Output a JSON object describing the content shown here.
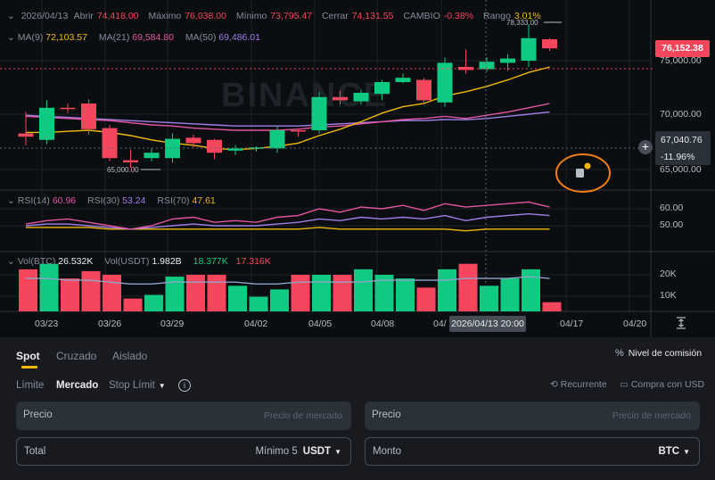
{
  "ohlc": {
    "date": "2026/04/13",
    "open_label": "Abrir",
    "open": "74,418.00",
    "max_label": "Máximo",
    "max": "76,038.00",
    "min_label": "Mínimo",
    "min": "73,795.47",
    "close_label": "Cerrar",
    "close": "74,131.55",
    "change_label": "CAMBIO",
    "change": "-0.38%",
    "range_label": "Rango",
    "range": "3.01%"
  },
  "ma": {
    "ma9_label": "MA(9)",
    "ma9": "72,103.57",
    "ma21_label": "MA(21)",
    "ma21": "69,584.80",
    "ma50_label": "MA(50)",
    "ma50": "69,486.01"
  },
  "rsi": {
    "rsi14_label": "RSI(14)",
    "rsi14": "60.96",
    "rsi30_label": "RSI(30)",
    "rsi30": "53.24",
    "rsi70_label": "RSI(70)",
    "rsi70": "47.61"
  },
  "vol": {
    "btc_label": "Vol(BTC)",
    "btc": "26.532K",
    "usdt_label": "Vol(USDT)",
    "usdt": "1.982B",
    "buy": "18.377K",
    "sell": "17.316K"
  },
  "price_axis": [
    "75,000.00",
    "70,000.00",
    "65,000.00"
  ],
  "rsi_axis": [
    "60.00",
    "50.00"
  ],
  "vol_axis": [
    "20K",
    "10K"
  ],
  "date_axis": [
    "03/23",
    "03/26",
    "03/29",
    "04/02",
    "04/05",
    "04/08",
    "04/",
    "04/17",
    "04/20"
  ],
  "current_price": "76,152.38",
  "crosshair_price": "67,040.76",
  "crosshair_pct": "-11.96%",
  "crosshair_date": "2026/04/13 20:00",
  "high_marker": "78,333.00",
  "low_marker": "65,000.00",
  "watermark": "BINANCE",
  "colors": {
    "up": "#0ecb81",
    "down": "#f6465d",
    "accent": "#f0b90b",
    "ma21": "#e255a1",
    "ma50": "#a07ee6"
  },
  "trade": {
    "tabs": [
      "Spot",
      "Cruzado",
      "Aislado"
    ],
    "fee_label": "Nivel de comisión",
    "order_types": [
      "Límite",
      "Mercado",
      "Stop Límit"
    ],
    "recurring": "Recurrente",
    "buy_usd": "Compra con USD",
    "left_price_label": "Precio",
    "left_price_placeholder": "Precio de mercado",
    "right_price_label": "Precio",
    "right_price_placeholder": "Precio de mercado",
    "total_label": "Total",
    "min_label": "Mínimo 5",
    "total_unit": "USDT",
    "amount_label": "Monto",
    "amount_unit": "BTC"
  },
  "chart_data": {
    "type": "candlestick",
    "candles": [
      {
        "o": 68200,
        "h": 70200,
        "l": 67100,
        "c": 67900
      },
      {
        "o": 67600,
        "h": 71300,
        "l": 67200,
        "c": 70600
      },
      {
        "o": 70600,
        "h": 71000,
        "l": 70100,
        "c": 70500
      },
      {
        "o": 71000,
        "h": 71400,
        "l": 68100,
        "c": 68600
      },
      {
        "o": 68700,
        "h": 69000,
        "l": 65600,
        "c": 65900
      },
      {
        "o": 65700,
        "h": 66700,
        "l": 65000,
        "c": 65500
      },
      {
        "o": 65900,
        "h": 66800,
        "l": 65600,
        "c": 66400
      },
      {
        "o": 65900,
        "h": 68200,
        "l": 65500,
        "c": 67700
      },
      {
        "o": 67800,
        "h": 68100,
        "l": 66900,
        "c": 67300
      },
      {
        "o": 67600,
        "h": 67700,
        "l": 65800,
        "c": 66400
      },
      {
        "o": 66600,
        "h": 67100,
        "l": 66200,
        "c": 66800
      },
      {
        "o": 66800,
        "h": 67000,
        "l": 66500,
        "c": 66900
      },
      {
        "o": 66800,
        "h": 68900,
        "l": 66400,
        "c": 68500
      },
      {
        "o": 68500,
        "h": 68700,
        "l": 67900,
        "c": 68400
      },
      {
        "o": 68500,
        "h": 72100,
        "l": 68200,
        "c": 71600
      },
      {
        "o": 71600,
        "h": 72200,
        "l": 70900,
        "c": 71300
      },
      {
        "o": 71200,
        "h": 72300,
        "l": 70900,
        "c": 72000
      },
      {
        "o": 71900,
        "h": 73200,
        "l": 71300,
        "c": 73000
      },
      {
        "o": 73000,
        "h": 73800,
        "l": 72900,
        "c": 73400
      },
      {
        "o": 73200,
        "h": 73400,
        "l": 70900,
        "c": 71300
      },
      {
        "o": 71100,
        "h": 75300,
        "l": 70700,
        "c": 74800
      },
      {
        "o": 74418,
        "h": 76038,
        "l": 73795,
        "c": 74131
      },
      {
        "o": 74200,
        "h": 75300,
        "l": 74000,
        "c": 74900
      },
      {
        "o": 74800,
        "h": 75600,
        "l": 74100,
        "c": 75200
      },
      {
        "o": 75000,
        "h": 78333,
        "l": 74400,
        "c": 77100
      },
      {
        "o": 77000,
        "h": 77100,
        "l": 75900,
        "c": 76152
      }
    ],
    "ma9": [
      68300,
      68300,
      68400,
      68500,
      68300,
      68000,
      67600,
      67300,
      67100,
      66800,
      66700,
      66800,
      67000,
      67300,
      68000,
      68600,
      69300,
      70100,
      70700,
      71000,
      71700,
      72100,
      72600,
      73200,
      73900,
      74400
    ],
    "ma21": [
      69800,
      69700,
      69600,
      69500,
      69400,
      69200,
      69000,
      68900,
      68700,
      68600,
      68500,
      68500,
      68500,
      68600,
      68800,
      68900,
      69100,
      69300,
      69500,
      69600,
      69800,
      69600,
      69900,
      70200,
      70600,
      71000
    ],
    "ma50": [
      69900,
      69800,
      69700,
      69600,
      69500,
      69400,
      69300,
      69200,
      69100,
      69000,
      68900,
      68900,
      68900,
      68900,
      69000,
      69100,
      69200,
      69300,
      69400,
      69400,
      69500,
      69486,
      69600,
      69800,
      70000,
      70200
    ],
    "rsi14": [
      51,
      53,
      54,
      52,
      50,
      48,
      50,
      54,
      55,
      52,
      53,
      52,
      55,
      56,
      60,
      58,
      61,
      60,
      62,
      59,
      63,
      61,
      62,
      63,
      64,
      61
    ],
    "rsi30": [
      50,
      51,
      51,
      50,
      49,
      48,
      49,
      50,
      51,
      50,
      50,
      50,
      51,
      52,
      54,
      53,
      55,
      54,
      55,
      54,
      56,
      53,
      55,
      56,
      57,
      56
    ],
    "rsi70": [
      49,
      49,
      49,
      49,
      48,
      48,
      48,
      48,
      48,
      48,
      48,
      48,
      48,
      48,
      49,
      48,
      48,
      48,
      48,
      48,
      48,
      47,
      48,
      48,
      48,
      48
    ],
    "volume": [
      23,
      26,
      18,
      22,
      20,
      7,
      9,
      19,
      20,
      20,
      14,
      8,
      12,
      20,
      20,
      20,
      23,
      20,
      18,
      13,
      23,
      26,
      14,
      18,
      23,
      5
    ],
    "vol_ma": [
      18,
      18,
      17,
      17,
      16,
      15,
      15,
      16,
      16,
      16,
      16,
      15,
      15,
      16,
      16,
      16,
      16,
      17,
      17,
      17,
      17,
      18,
      18,
      18,
      19,
      18
    ]
  }
}
